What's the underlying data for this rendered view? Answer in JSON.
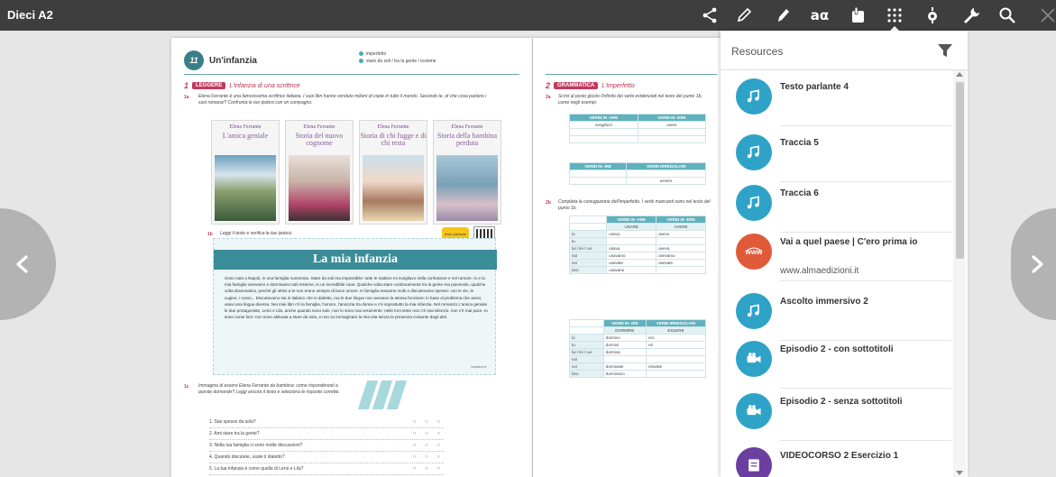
{
  "app": {
    "title": "Dieci A2"
  },
  "toolbar": {
    "icons": [
      "share-icon",
      "pen-icon",
      "marker-icon",
      "text-size-icon",
      "touch-icon",
      "grid-menu-icon",
      "location-icon",
      "wrench-icon",
      "search-icon",
      "close-icon"
    ],
    "text_size_label": "aα",
    "active_color": "#4a90d9"
  },
  "book": {
    "left": {
      "unit_number": "11",
      "unit_title": "Un'infanzia",
      "topics": [
        "imperfetto",
        "stare da soli / tra la gente / insieme"
      ],
      "section1_num": "1",
      "section1_pill": "LEGGERE",
      "section1_title": "L'infanzia di una scrittrice",
      "ex1a_label": "1a",
      "ex1a_text": "Elena Ferrante è una famosissima scrittrice italiana. I suoi libri hanno venduto milioni di copie in tutto il mondo. Secondo te, di che cosa parlano i suoi romanzi? Confronta le tue ipotesi con un compagno.",
      "covers": [
        {
          "author": "Elena Ferrante",
          "title": "L'amica geniale"
        },
        {
          "author": "Elena Ferrante",
          "title": "Storia del nuovo cognome"
        },
        {
          "author": "Elena Ferrante",
          "title": "Storia di chi fugge e di chi resta"
        },
        {
          "author": "Elena Ferrante",
          "title": "Storia della bambina perduta"
        }
      ],
      "ex1b_label": "1b",
      "ex1b_text": "Leggi il testo e verifica le tue ipotesi.",
      "sticker": "testo parlante",
      "reading_title": "La mia infanzia",
      "reading_body": "Sono nata a Napoli, in una famiglia numerosa. Stare da soli era impossibile: tutte le mattine mi svegliavo nella confusione e nel rumore. Io e la mia famiglia vivevamo e dormivamo tutti insieme, in un incredibile caos. Qualche volta stare continuamente tra la gente era piacevole, qualche volta drammatica, perché gli ultimi a te non erano sempre di buon umore. In famiglia eravamo molti e discutevamo spesso: con le zie, le cugine, i nonni... Discutevamo sia in italiano che in dialetto, ma le due lingue non avevano la stessa funzione: in base al problema che avevi, usavi una lingua diversa. Nei miei libri c'è la famiglia, l'amore, l'amicizia tra donne e c'è soprattutto la mia infanzia. Nel romanzo L'amica geniale le due protagoniste, Lenù e Lila, anche quando sono sole, non lo sono mai veramente: nelle loro teste non c'è mai silenzio, non c'è mai pace. Io sono come loro: non sono abituata a stare da sola, e non so immaginare la mia vita senza la presenza costante degli altri.",
      "reading_source": "corriere.it",
      "ex1c_label": "1c",
      "ex1c_text": "Immagina di essere Elena Ferrante da bambina: come risponderesti a queste domande? Leggi ancora il testo e seleziona le risposte corrette.",
      "quiz": [
        "1. Stai spesso da sola?",
        "2. Ami stare tra la gente?",
        "3. Nella tua famiglia ci sono molte discussioni?",
        "4. Quando discutete, usate il dialetto?",
        "5. La tua infanzia è come quella di Lenù e Lila?"
      ],
      "quiz_options": "○ ○ ○"
    },
    "right": {
      "section2_num": "2",
      "section2_pill": "GRAMMATICA",
      "section2_title": "L'imperfetto",
      "ex2a_label": "2a",
      "ex2a_text": "Scrivi al posto giusto l'infinito dei verbi evidenziati nel testo del punto 1b, come negli esempi.",
      "table1_headers": [
        "VERBI IN -ARE",
        "VERBI IN -ERE"
      ],
      "table1_examples": [
        "svegliarsi",
        "avere"
      ],
      "table2_headers": [
        "VERBI IN -IRE",
        "VERBI IRREGOLARI"
      ],
      "table2_example": "essere",
      "ex2b_label": "2b",
      "ex2b_text": "Completa la coniugazione dell'imperfetto. I verbi mancanti sono nel testo del punto 1b.",
      "conj1_headers": [
        "VERBI IN -ARE",
        "VERBI IN -ERE"
      ],
      "conj1_verbs": [
        "USARE",
        "AVERE"
      ],
      "conj1_rows": [
        [
          "io",
          "usavo",
          "avevo"
        ],
        [
          "tu",
          "",
          ""
        ],
        [
          "lui / lei / Lei",
          "usava",
          "aveva"
        ],
        [
          "noi",
          "usavamo",
          "avevamo"
        ],
        [
          "voi",
          "usavate",
          "avevate"
        ],
        [
          "loro",
          "usavano",
          ""
        ]
      ],
      "conj2_headers": [
        "VERBI IN -IRE",
        "VERBI IRREGOLARI"
      ],
      "conj2_verbs": [
        "DORMIRE",
        "ESSERE"
      ],
      "conj2_rows": [
        [
          "io",
          "dormivo",
          "ero"
        ],
        [
          "tu",
          "dormivi",
          "eri"
        ],
        [
          "lui / lei / Lei",
          "dormiva",
          ""
        ],
        [
          "noi",
          "",
          ""
        ],
        [
          "voi",
          "dormivate",
          "eravate"
        ],
        [
          "loro",
          "dormivano",
          ""
        ]
      ]
    }
  },
  "panel": {
    "title": "Resources",
    "items": [
      {
        "title": "Testo parlante 4",
        "subtitle": "",
        "icon": "audio-icon",
        "color": "#2ea3c7"
      },
      {
        "title": "Traccia 5",
        "subtitle": "",
        "icon": "audio-icon",
        "color": "#2ea3c7"
      },
      {
        "title": "Traccia 6",
        "subtitle": "",
        "icon": "audio-icon",
        "color": "#2ea3c7"
      },
      {
        "title": "Vai a quel paese | C'ero prima io",
        "subtitle": "www.almaedizioni.it",
        "icon": "web-link-icon",
        "color": "#e05a3a"
      },
      {
        "title": "Ascolto immersivo 2",
        "subtitle": "",
        "icon": "audio-icon",
        "color": "#2ea3c7"
      },
      {
        "title": "Episodio 2 - con sottotitoli",
        "subtitle": "",
        "icon": "video-icon",
        "color": "#2ea3c7"
      },
      {
        "title": "Episodio 2 - senza sottotitoli",
        "subtitle": "",
        "icon": "video-icon",
        "color": "#2ea3c7"
      },
      {
        "title": "VIDEOCORSO 2    Esercizio 1",
        "subtitle": "",
        "icon": "exercise-icon",
        "color": "#6b3fa0"
      }
    ]
  },
  "colors": {
    "topbar": "#3e3e3e",
    "accent_teal": "#3a8d98",
    "accent_red": "#c13a5b"
  }
}
